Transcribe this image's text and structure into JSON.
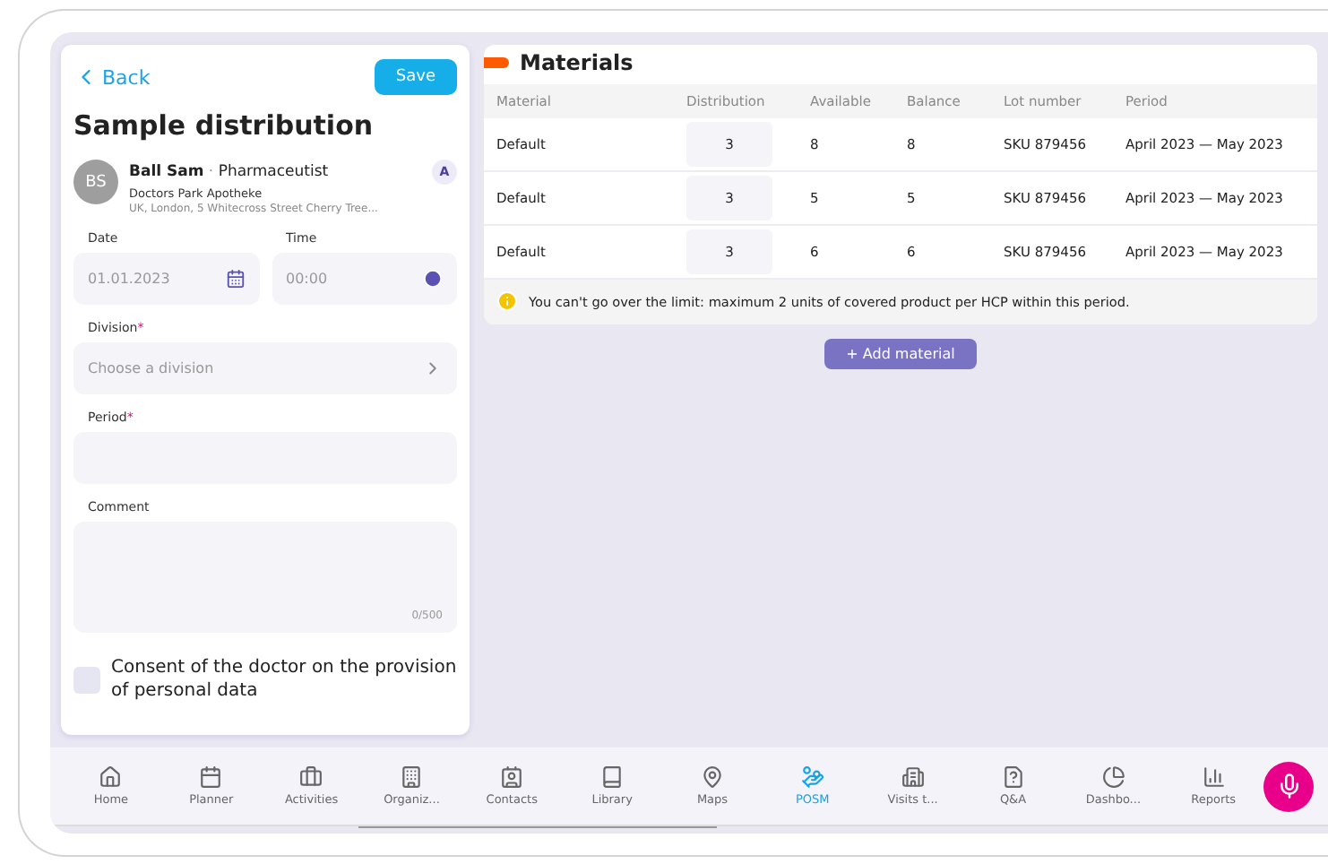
{
  "form": {
    "back": "Back",
    "save": "Save",
    "title": "Sample distribution",
    "contact": {
      "initials": "BS",
      "name": "Ball Sam",
      "separator": "·",
      "role": "Pharmaceutist",
      "organization": "Doctors Park Apotheke",
      "address": "UK, London, 5 Whitecross Street Cherry Tree...",
      "badge": "A"
    },
    "date": {
      "label": "Date",
      "placeholder": "01.01.2023"
    },
    "time": {
      "label": "Time",
      "placeholder": "00:00"
    },
    "division": {
      "label": "Division",
      "required_mark": "*",
      "placeholder": "Choose a division"
    },
    "period": {
      "label": "Period",
      "required_mark": "*"
    },
    "comment": {
      "label": "Comment",
      "counter": "0/500"
    },
    "consent": {
      "label": "Consent of the doctor on the provision of personal data",
      "checked": false
    }
  },
  "materials": {
    "title": "Materials",
    "columns": [
      "Material",
      "Distribution",
      "Available",
      "Balance",
      "Lot number",
      "Period"
    ],
    "rows": [
      {
        "material": "Default",
        "distribution": "3",
        "available": "8",
        "balance": "8",
        "lot": "SKU 879456",
        "period": "April 2023 — May 2023"
      },
      {
        "material": "Default",
        "distribution": "3",
        "available": "5",
        "balance": "5",
        "lot": "SKU 879456",
        "period": "April 2023 — May 2023"
      },
      {
        "material": "Default",
        "distribution": "3",
        "available": "6",
        "balance": "6",
        "lot": "SKU 879456",
        "period": "April 2023 — May 2023"
      }
    ],
    "warning": "You can't go over the limit: maximum 2 units of covered product per HCP within this period.",
    "add_button": "+ Add material"
  },
  "tab_bar": [
    {
      "label": "Home",
      "selected": false
    },
    {
      "label": "Planner",
      "selected": false
    },
    {
      "label": "Activities",
      "selected": false
    },
    {
      "label": "Organiz...",
      "selected": false
    },
    {
      "label": "Contacts",
      "selected": false
    },
    {
      "label": "Library",
      "selected": false
    },
    {
      "label": "Maps",
      "selected": false
    },
    {
      "label": "POSM",
      "selected": true
    },
    {
      "label": "Visits t...",
      "selected": false
    },
    {
      "label": "Q&A",
      "selected": false
    },
    {
      "label": "Dashbo...",
      "selected": false
    },
    {
      "label": "Reports",
      "selected": false
    }
  ]
}
